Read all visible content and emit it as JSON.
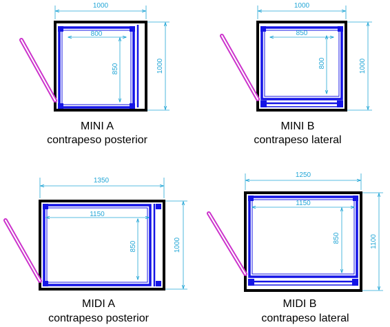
{
  "colors": {
    "shaft": "#000000",
    "cabin": "#1414e6",
    "dimension": "#22a6d6",
    "door": "#cc33cc",
    "text": "#000000"
  },
  "plans": {
    "mini_a": {
      "name": "MINI A",
      "subtitle": "contrapeso posterior",
      "shaft_width": "1000",
      "shaft_depth": "1000",
      "cabin_width": "800",
      "cabin_depth": "850"
    },
    "mini_b": {
      "name": "MINI B",
      "subtitle": "contrapeso lateral",
      "shaft_width": "1000",
      "shaft_depth": "1000",
      "cabin_width": "850",
      "cabin_depth": "800"
    },
    "midi_a": {
      "name": "MIDI A",
      "subtitle": "contrapeso posterior",
      "shaft_width": "1350",
      "shaft_depth": "1000",
      "cabin_width": "1150",
      "cabin_depth": "850"
    },
    "midi_b": {
      "name": "MIDI B",
      "subtitle": "contrapeso lateral",
      "shaft_width": "1250",
      "shaft_depth": "1100",
      "cabin_width": "1150",
      "cabin_depth": "850"
    }
  }
}
